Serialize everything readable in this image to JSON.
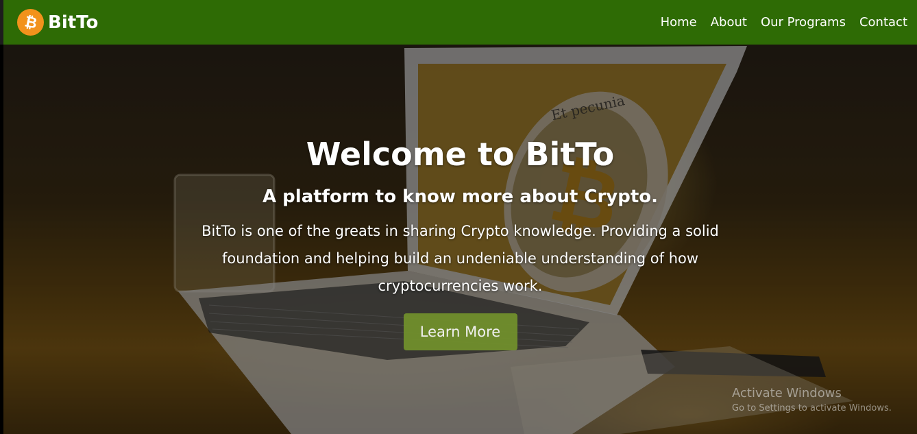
{
  "navbar": {
    "brand_logo_icon": "bitcoin-icon",
    "brand_logo_glyph": "₿",
    "brand_name": "BitTo",
    "links": [
      {
        "label": "Home"
      },
      {
        "label": "About"
      },
      {
        "label": "Our Programs"
      },
      {
        "label": "Contact"
      }
    ],
    "background_color": "#2e6b05",
    "logo_color": "#f2921c"
  },
  "hero": {
    "title": "Welcome to BitTo",
    "subtitle": "A platform to know more about Crypto.",
    "description": "BitTo is one of the greats in sharing Crypto knowledge. Providing a solid foundation and helping build an undeniable understanding of how cryptocurrencies work.",
    "button_label": "Learn More",
    "button_color": "#72912c",
    "background_image": "laptop with bitcoin coin on wooden desk",
    "coin_inscription": "Et pecunia"
  },
  "os_watermark": {
    "title": "Activate Windows",
    "subtitle": "Go to Settings to activate Windows."
  }
}
